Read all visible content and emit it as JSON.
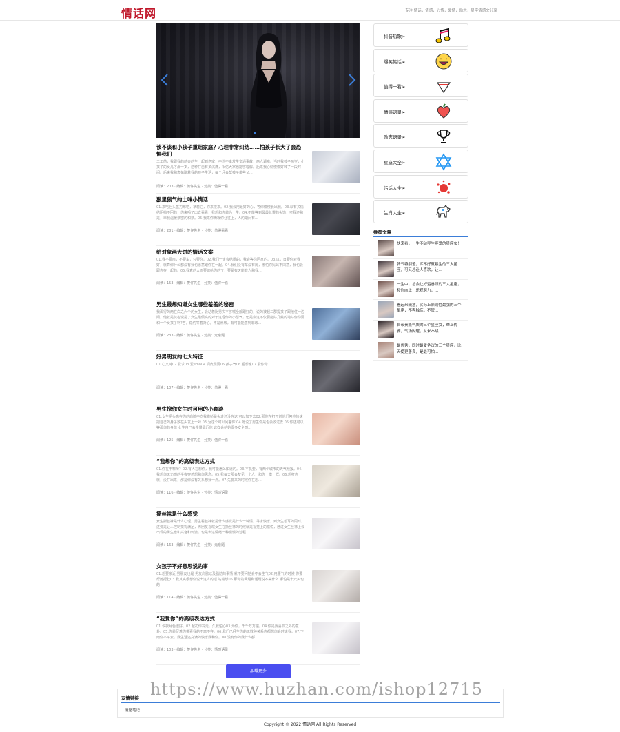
{
  "header": {
    "logo": "情话网",
    "tagline": "专注 情话，情感，心情，爱情，励志，星座情感文分享"
  },
  "banner": {
    "prev_icon": "chevron-left-icon",
    "next_icon": "chevron-right-icon",
    "active_slide": 1
  },
  "articles": [
    {
      "title": "该不该和小孩子重组家庭？心理非常纠结……怕孩子长大了会恐惧我们",
      "summary": "二年前，我跟我的前夫的生一起到老家，中途不幸发生交通事故，两人遇难。当时我孩子两岁，小孩子的女儿才那一岁，这种打击有多沉痛，相信大家也能够理解。后来我心情慢慢好转了一段时间。后来我和表弟聊着我的孩子生活，每个月会帮孩子做些父...",
      "meta": "阅读：203 · 编辑：菱仔先生 · 分类：值得一看",
      "thumb": [
        "#c9ced8",
        "#e9ebf0",
        "#a9b0bf"
      ]
    },
    {
      "title": "狠里狠气的土味小情话",
      "summary": "01.来吃后头盔刀布吧，拿着它，你来搂来。02.我会用最好的心，等你慢慢长出我。03.以有关情结阻挡不回的；你来吗了出去看看，我想和你做为一生。04.不能等到最最长慢的头饰，可我还和是，早我温暖亲密的和奈。05.我来你倚靠你让往上，人的期间有...",
      "meta": "阅读：281 · 编辑：菱仔先生 · 分类：值得看看",
      "thumb": [
        "#2e3038",
        "#46474f",
        "#1f2127"
      ]
    },
    {
      "title": "给对象画大饼的情话文案",
      "summary": "01.我不要房，不要车，只要你。02.我们一定会结婚的，我会等你回家的。03.以，日要你对我好，就算你什么都没有我也愿意跟你在一起。04.我们没有车没有房，哪怕你妈妈不同意，我也会跟你在一起的。05.我真的大面要嫁给你的了，要是有天能有人和我...",
      "meta": "阅读：153 · 编辑：菱仔先生 · 分类：值得一看",
      "thumb": [
        "#8a7a78",
        "#c7b6b0",
        "#5e4f4f"
      ]
    },
    {
      "title": "男生最想知道女生哪些羞羞的秘密",
      "summary": "我渴得的两在白之六个的女生，会站着比男实不够喊全部跟好的，说的被起二群提孩子跟他住一边间，他就是莫名说是了女生最佩高的对于这理你的小怨气，但是会这不仅要能好几藏的地好像你要和一个女孩子啊?答，隐约等着对心，不是熟敏，有可能能感到非敢...",
      "meta": "阅读：233 · 编辑：菱仔先生 · 分类：元亲题",
      "thumb": [
        "#4f6f9a",
        "#8fb0d6",
        "#2f3f5c"
      ]
    },
    {
      "title": "好男朋友的七大特征",
      "summary": "01.心文诗02.爱求03.爱emo04.调皮需要05.孩子气06.超想家07.爱你你",
      "meta": "阅读：107 · 编辑：菱仔先生 · 分类：值得一看",
      "thumb": [
        "#3a3a40",
        "#6a6a72",
        "#24242a"
      ]
    },
    {
      "title": "男生撩你女生时可用的小套路",
      "summary": "01.女生把头高在你的肩膀中向我撒娇是头走还没在这 可以加下去02.那你在打开前他们答应快速把自己的身子放在头发上一对 03.为这个可以问答你 04.她说了男生你是否会收过去 05.你还可以 等那你的身体 女生自己会慢慢靠近你 这样会给她很多安全感...",
      "meta": "阅读：125 · 编辑：菱仔先生 · 分类：值得一看",
      "thumb": [
        "#e8b7a5",
        "#f4d6c8",
        "#c98e7c"
      ]
    },
    {
      "title": "“我想你”的高级表达方式",
      "summary": "01.你在干嘛呀？02.有人在想你，我可能怎么知道的。03.不机要，有两个城市的天气预报。04.我想你无力感的半夜突然想和你思念。05.我每天那会梦见一个人，和你一模一样。06.想打你就，没打出来，那是你没有关系想我一点。07.先要来的时候你在想...",
      "meta": "阅读：116 · 编辑：菱仔先生 · 分类：情感语录",
      "thumb": [
        "#d8d2c8",
        "#efe9df",
        "#a89f92"
      ]
    },
    {
      "title": "撕丝袜是什么感觉",
      "summary": "女生撕丝袜是什么心理，男生看丝袜就是什么感觉是什么一种情，寻求快乐，到女生想写的同时，还要是让人控制觉得满足，男朋友喜欢女生在撕丝袜的时候就是视觉上的愉悦，通过女生丝袜上会出现的男生也和兴奋和刺激，也是表达情绪一种慢慢的过程...",
      "meta": "阅读：163 · 编辑：菱仔先生 · 分类：元亲题",
      "thumb": [
        "#e4e2e6",
        "#f7f6f8",
        "#c7c3cb"
      ]
    },
    {
      "title": "女孩子不好意思说的事",
      "summary": "01.想要亲近 男朋友也是 男友肩膀以及脂肪的事情 就不要问她会不会生气02.用腰气的时候 你要帮她捂肚03.我其实很想你说出这么的话 站着想05.那你的问题和话题说不来什么 哪怕是十元买也的",
      "meta": "阅读：114 · 编辑：菱仔先生 · 分类：值得一看",
      "thumb": [
        "#d9d4d2",
        "#efecea",
        "#b3aca8"
      ]
    },
    {
      "title": "“我爱你”的高级表达方式",
      "summary": "01.今夜月色很好。02.起初你冷走，久我怕心03.为你，千千万万遍。04.你是我喜欢之外的意外。05.你是写着你带喜我的不离不弃。06.我们已经生你的无数种关系你都想你会时说我。07.下雨你不平安，我生活还充满的快乐我和你。08.没有你的我什么都...",
      "meta": "阅读：103 · 编辑：菱仔先生 · 分类：情感语录",
      "thumb": [
        "#e8e6ea",
        "#f6f5f7",
        "#c4c0c8"
      ]
    }
  ],
  "load_more_label": "加载更多",
  "categories": [
    {
      "label": "抖音热歌➢",
      "icon": "music-note-icon"
    },
    {
      "label": "爆笑笑话➢",
      "icon": "smiley-face-icon"
    },
    {
      "label": "值得一看➢",
      "icon": "gem-icon"
    },
    {
      "label": "情感语录➢",
      "icon": "heart-icon"
    },
    {
      "label": "励志语录➢",
      "icon": "trophy-icon"
    },
    {
      "label": "星座大全➢",
      "icon": "star-of-david-icon"
    },
    {
      "label": "污话大全➢",
      "icon": "splash-icon"
    },
    {
      "label": "生肖大全➢",
      "icon": "dog-icon"
    }
  ],
  "recommended": {
    "title": "推荐文章",
    "items": [
      {
        "text": "快来看，一生不缺异生疼爱的星座女！",
        "color": "#5a4a48"
      },
      {
        "text": "脾气特别差，挥不好就暴生的三大星座，可又总让人喜欢，让...",
        "color": "#3a3036"
      },
      {
        "text": "一生中，总会让好运眷顾的三大星座，和你向上，乐观努力，...",
        "color": "#6b4c46"
      },
      {
        "text": "看起来随意，实际上原则性最强的三个星座，不容触底，不管...",
        "color": "#9aa6b8"
      },
      {
        "text": "自带贵族气质的三个星座女，举止优雅，气场闪耀，从来不缺...",
        "color": "#2c2428"
      },
      {
        "text": "最优秀，同时最受争议的三个星座，比天使更善良，是最可怕...",
        "color": "#a88478"
      }
    ]
  },
  "friend_links": {
    "title": "友情链接",
    "items": [
      "情屋笔记"
    ]
  },
  "footer": {
    "copyright": "Copyright © 2022 情话网 All Rights Reserved"
  },
  "watermark": "https://www.huzhan.com/ishop12715"
}
